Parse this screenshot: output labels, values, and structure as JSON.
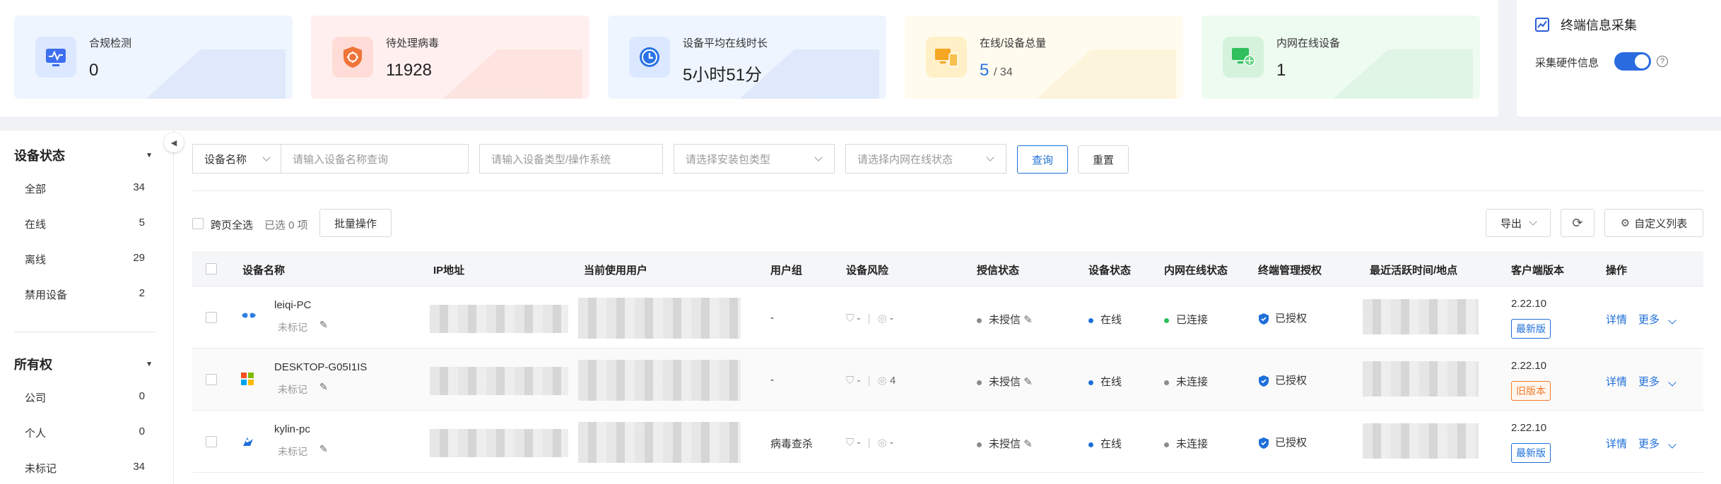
{
  "stats": [
    {
      "label": "合规检测",
      "value": "0",
      "icon": "chart-monitor-icon",
      "bg": "#eef5ff",
      "iconBg": "#dbe8ff",
      "iconColor": "#3d6ff0"
    },
    {
      "label": "待处理病毒",
      "value": "11928",
      "icon": "virus-shield-icon",
      "bg": "#fff0ef",
      "iconBg": "#ffdcd7",
      "iconColor": "#f0743a"
    },
    {
      "label": "设备平均在线时长",
      "value": "5小时51分",
      "icon": "clock-icon",
      "bg": "#eef5ff",
      "iconBg": "#dbe8ff",
      "iconColor": "#2a72e6"
    },
    {
      "label": "在线/设备总量",
      "value_online": "5",
      "value_total": "/ 34",
      "icon": "devices-icon",
      "bg": "#fffbee",
      "iconBg": "#fff0c8",
      "iconColor": "#f5a623"
    },
    {
      "label": "内网在线设备",
      "value": "1",
      "icon": "network-device-icon",
      "bg": "#eefbf1",
      "iconBg": "#d5f3dc",
      "iconColor": "#2fbf5d"
    }
  ],
  "collect": {
    "title": "终端信息采集",
    "toggle_label": "采集硬件信息",
    "toggle_on": true
  },
  "sidebar": {
    "status_title": "设备状态",
    "status_items": [
      {
        "label": "全部",
        "count": "34"
      },
      {
        "label": "在线",
        "count": "5"
      },
      {
        "label": "离线",
        "count": "29"
      },
      {
        "label": "禁用设备",
        "count": "2"
      }
    ],
    "owner_title": "所有权",
    "owner_items": [
      {
        "label": "公司",
        "count": "0"
      },
      {
        "label": "个人",
        "count": "0"
      },
      {
        "label": "未标记",
        "count": "34"
      }
    ]
  },
  "filters": {
    "field_select": "设备名称",
    "name_placeholder": "请输入设备名称查询",
    "type_placeholder": "请输入设备类型/操作系统",
    "package_placeholder": "请选择安装包类型",
    "lan_placeholder": "请选择内网在线状态",
    "query": "查询",
    "reset": "重置"
  },
  "toolbar": {
    "select_all": "跨页全选",
    "selected": "已选 0 项",
    "batch": "批量操作",
    "export": "导出",
    "custom": "自定义列表"
  },
  "columns": [
    "设备名称",
    "IP地址",
    "当前使用用户",
    "用户组",
    "设备风险",
    "授信状态",
    "设备状态",
    "内网在线状态",
    "终端管理授权",
    "最近活跃时间/地点",
    "客户端版本",
    "操作"
  ],
  "rows": [
    {
      "name": "leiqi-PC",
      "mark": "未标记",
      "os_icon": "kylin-icon",
      "group": "-",
      "risk1": "-",
      "risk2": "-",
      "trust": "未授信",
      "status": "在线",
      "lan": "已连接",
      "lanColor": "#2fbf5d",
      "auth": "已授权",
      "version": "2.22.10",
      "ver_tag": "最新版",
      "tagColor": "#1e6fd9",
      "tagBg": "#fff",
      "detail": "详情",
      "more": "更多"
    },
    {
      "name": "DESKTOP-G05I1IS",
      "mark": "未标记",
      "os_icon": "windows-icon",
      "group": "-",
      "risk1": "-",
      "risk2": "4",
      "trust": "未授信",
      "status": "在线",
      "lan": "未连接",
      "lanColor": "#8c8c8c",
      "auth": "已授权",
      "version": "2.22.10",
      "ver_tag": "旧版本",
      "tagColor": "#f07a2a",
      "tagBg": "#fff7ef",
      "detail": "详情",
      "more": "更多"
    },
    {
      "name": "kylin-pc",
      "mark": "未标记",
      "os_icon": "kylin-bird-icon",
      "group": "病毒查杀",
      "risk1": "-",
      "risk2": "-",
      "trust": "未授信",
      "status": "在线",
      "lan": "未连接",
      "lanColor": "#8c8c8c",
      "auth": "已授权",
      "version": "2.22.10",
      "ver_tag": "最新版",
      "tagColor": "#1e6fd9",
      "tagBg": "#fff",
      "detail": "详情",
      "more": "更多"
    }
  ]
}
